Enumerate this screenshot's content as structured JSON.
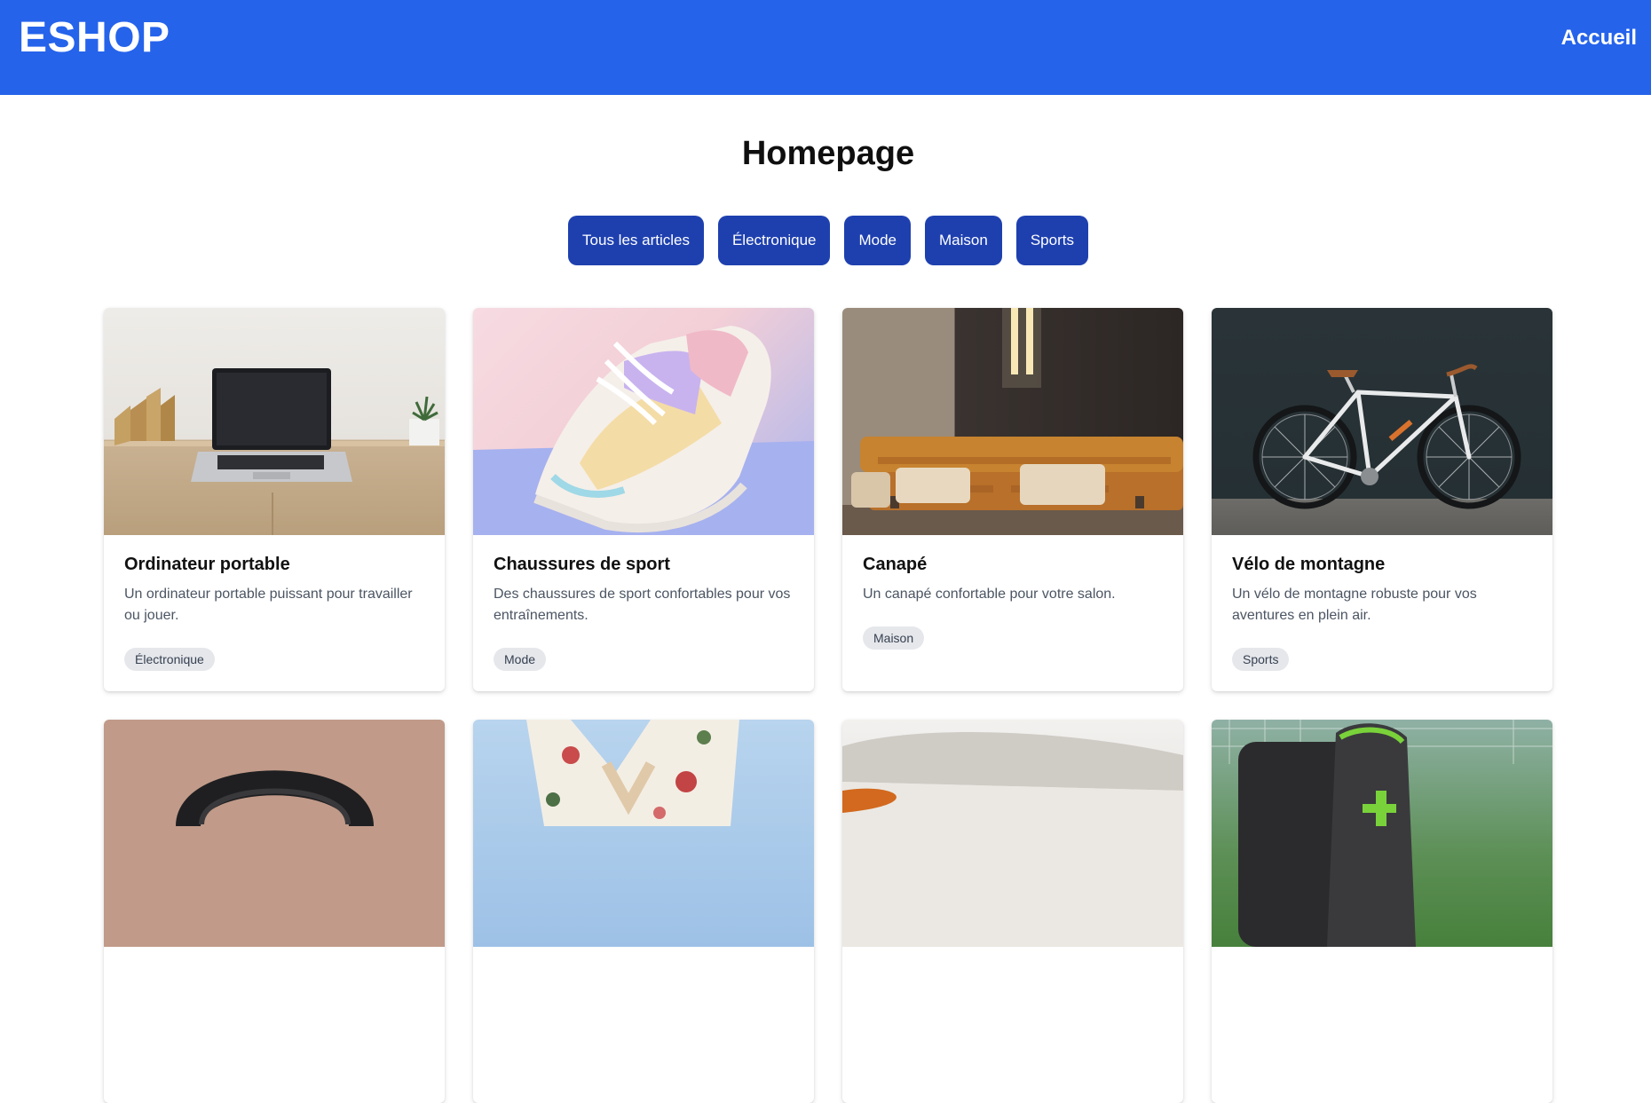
{
  "navbar": {
    "brand": "ESHOP",
    "home_link": "Accueil"
  },
  "page": {
    "title": "Homepage"
  },
  "filters": [
    "Tous les articles",
    "Électronique",
    "Mode",
    "Maison",
    "Sports"
  ],
  "products": [
    {
      "title": "Ordinateur portable",
      "description": "Un ordinateur portable puissant pour travailler ou jouer.",
      "category": "Électronique"
    },
    {
      "title": "Chaussures de sport",
      "description": "Des chaussures de sport confortables pour vos entraînements.",
      "category": "Mode"
    },
    {
      "title": "Canapé",
      "description": "Un canapé confortable pour votre salon.",
      "category": "Maison"
    },
    {
      "title": "Vélo de montagne",
      "description": "Un vélo de montagne robuste pour vos aventures en plein air.",
      "category": "Sports"
    }
  ],
  "colors": {
    "navbar": "#2563eb",
    "filter_button": "#1e40af",
    "badge": "#e5e7eb"
  }
}
